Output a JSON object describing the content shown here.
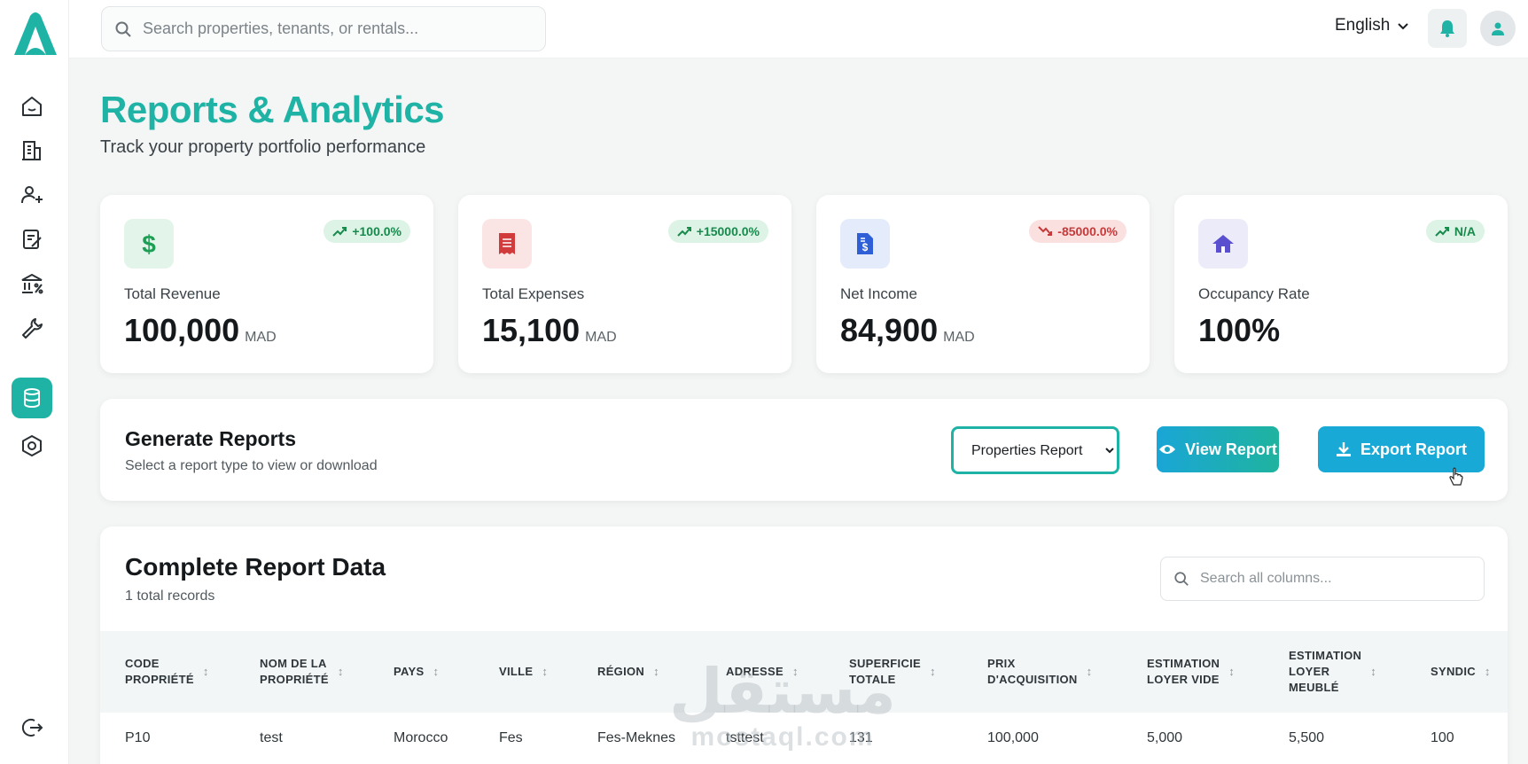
{
  "topbar": {
    "search_placeholder": "Search properties, tenants, or rentals...",
    "language": "English"
  },
  "header": {
    "title": "Reports & Analytics",
    "subtitle": "Track your property portfolio performance"
  },
  "stats": [
    {
      "label": "Total Revenue",
      "value": "100,000",
      "unit": "MAD",
      "badge": "+100.0%",
      "trend": "up",
      "icon": "dollar-icon",
      "color": "#1e9e55"
    },
    {
      "label": "Total Expenses",
      "value": "15,100",
      "unit": "MAD",
      "badge": "+15000.0%",
      "trend": "up",
      "icon": "receipt-icon",
      "color": "#d13b3b"
    },
    {
      "label": "Net Income",
      "value": "84,900",
      "unit": "MAD",
      "badge": "-85000.0%",
      "trend": "down",
      "icon": "invoice-icon",
      "color": "#2f5fd6"
    },
    {
      "label": "Occupancy Rate",
      "value": "100%",
      "unit": "",
      "badge": "N/A",
      "trend": "up",
      "icon": "home-icon",
      "color": "#5a4fcf"
    }
  ],
  "generate": {
    "title": "Generate Reports",
    "subtitle": "Select a report type to view or download",
    "selected_report": "Properties Report",
    "view_label": "View Report",
    "export_label": "Export Report"
  },
  "table": {
    "title": "Complete Report Data",
    "records": "1 total records",
    "search_placeholder": "Search all columns...",
    "columns": [
      {
        "l1": "CODE",
        "l2": "PROPRIÉTÉ",
        "l3": ""
      },
      {
        "l1": "NOM DE LA",
        "l2": "PROPRIÉTÉ",
        "l3": ""
      },
      {
        "l1": "PAYS",
        "l2": "",
        "l3": ""
      },
      {
        "l1": "VILLE",
        "l2": "",
        "l3": ""
      },
      {
        "l1": "RÉGION",
        "l2": "",
        "l3": ""
      },
      {
        "l1": "ADRESSE",
        "l2": "",
        "l3": ""
      },
      {
        "l1": "SUPERFICIE",
        "l2": "TOTALE",
        "l3": ""
      },
      {
        "l1": "PRIX",
        "l2": "D'ACQUISITION",
        "l3": ""
      },
      {
        "l1": "ESTIMATION",
        "l2": "LOYER VIDE",
        "l3": ""
      },
      {
        "l1": "ESTIMATION",
        "l2": "LOYER",
        "l3": "MEUBLÉ"
      },
      {
        "l1": "SYNDIC",
        "l2": "",
        "l3": ""
      }
    ],
    "rows": [
      [
        "P10",
        "test",
        "Morocco",
        "Fes",
        "Fes-Meknes",
        "tsttest",
        "131",
        "100,000",
        "5,000",
        "5,500",
        "100"
      ]
    ]
  },
  "watermark": {
    "arabic": "مستقل",
    "latin": "mostaql.com"
  }
}
